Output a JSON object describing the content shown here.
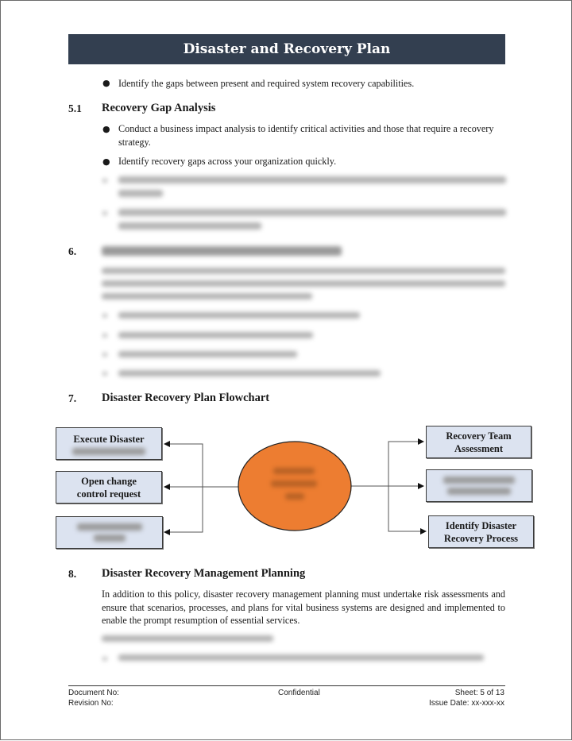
{
  "header": {
    "title": "Disaster and Recovery Plan"
  },
  "intro_bullets": [
    "Identify the gaps between present and required system recovery capabilities."
  ],
  "section_5_1": {
    "number": "5.1",
    "title": "Recovery Gap Analysis",
    "bullets": [
      "Conduct a business impact analysis to identify critical activities and those that require a recovery strategy.",
      "Identify recovery gaps across your organization quickly."
    ],
    "blurred_bullets_count": 2
  },
  "section_6": {
    "number": "6.",
    "title_blurred": true,
    "blurred_paragraph_lines": 3,
    "blurred_bullets_count": 4
  },
  "section_7": {
    "number": "7.",
    "title": "Disaster Recovery Plan Flowchart",
    "flowchart": {
      "center_node": {
        "label_blurred": true,
        "color": "#ed7d31"
      },
      "left_nodes": [
        {
          "label": "Execute Disaster",
          "partially_blurred": true
        },
        {
          "label": "Open change control request",
          "partially_blurred": false
        },
        {
          "label": "",
          "blurred": true
        }
      ],
      "right_nodes": [
        {
          "label": "Recovery Team Assessment",
          "blurred": false
        },
        {
          "label": "",
          "blurred": true
        },
        {
          "label": "Identify Disaster Recovery Process",
          "blurred": false
        }
      ],
      "box_fill": "#dce3f0"
    }
  },
  "section_8": {
    "number": "8.",
    "title": "Disaster Recovery Management Planning",
    "paragraph": "In addition to this policy, disaster recovery management planning must undertake risk assessments and ensure that scenarios, processes, and plans for vital business systems are designed and implemented to enable the prompt resumption of essential services.",
    "blurred_lines": 2
  },
  "footer": {
    "document_no_label": "Document No:",
    "revision_no_label": "Revision No:",
    "classification": "Confidential",
    "sheet": "Sheet: 5 of 13",
    "issue_date": "Issue Date: xx-xxx-xx"
  },
  "colors": {
    "title_bar": "#333f50",
    "accent_orange": "#ed7d31",
    "box_fill": "#dce3f0"
  }
}
